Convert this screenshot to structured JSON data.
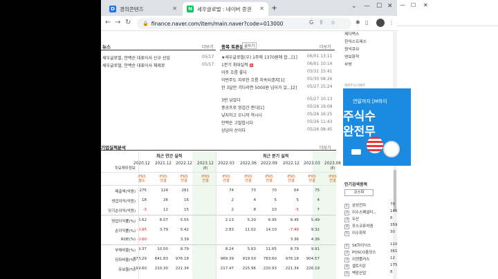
{
  "browser": {
    "tabs": [
      {
        "label": "경의콘텐즈",
        "favicon": "D",
        "favicon_color": "#1a73e8",
        "active": false
      },
      {
        "label": "세우글로벌 : 네이버 증권",
        "favicon": "N",
        "favicon_color": "#03c75a",
        "active": true
      }
    ],
    "url": "finance.naver.com/item/main.naver?code=013000"
  },
  "news": {
    "title": "뉴스",
    "more": "더보기",
    "items": [
      {
        "text": "세우글로벌, 안백순 대표이사 신규 선임",
        "date": "05/17"
      },
      {
        "text": "세우글로벌, 안백순 대표이사 체제로",
        "date": "05/17"
      }
    ]
  },
  "board": {
    "title": "종목 토론실",
    "write": "글쓰기",
    "more": "더보기",
    "items": [
      {
        "text": "★세우글로벌(우) 1주에 1370원에 합...[1]",
        "badge": true,
        "date": "06/01 13:11"
      },
      {
        "text": "1분기 최대실적",
        "badge": true,
        "date": "06/01 10:14"
      },
      {
        "text": "이주 흐름 좋다",
        "badge": false,
        "date": "05/31 15:41"
      },
      {
        "text": "이번주도 지루한 흐름 지속되겠지[1]",
        "badge": false,
        "date": "05/30 08:26"
      },
      {
        "text": "한 3달만 기다리면 5000원 넘어가 있...[2]",
        "badge": false,
        "date": "05/27 15:24"
      },
      {
        "text": "3번 남았다",
        "badge": false,
        "date": "05/27 10:13"
      },
      {
        "text": "중공프로 엉겁간 준다[1]",
        "badge": false,
        "date": "05/26 19:09"
      },
      {
        "text": "낮지하고 오니까 역시나",
        "badge": false,
        "date": "05/26 16:25"
      },
      {
        "text": "안백순 고발합시다",
        "badge": false,
        "date": "05/26 11:43"
      },
      {
        "text": "상넘어 산이다",
        "badge": false,
        "date": "05/26 08:45"
      }
    ]
  },
  "financials": {
    "title": "기업실적분석",
    "more": "더보기",
    "annual_label": "최근 연간 실적",
    "quarter_label": "최근 분기 실적",
    "main_info_label": "주요재무정보",
    "ifrs_label": "IFRS",
    "annual_cols": [
      {
        "year": "2020.12",
        "basis": "별도"
      },
      {
        "year": "2021.12",
        "basis": "연결"
      },
      {
        "year": "2022.12",
        "basis": "연결"
      },
      {
        "year": "2023.12",
        "suffix": "(E)",
        "basis": "연결"
      }
    ],
    "quarter_cols": [
      {
        "year": "2022.03",
        "basis": "연결"
      },
      {
        "year": "2022.06",
        "basis": "연결"
      },
      {
        "year": "2022.09",
        "basis": "연결"
      },
      {
        "year": "2022.12",
        "basis": "연결"
      },
      {
        "year": "2023.03",
        "basis": "연결"
      },
      {
        "year": "2023.06",
        "suffix": "(E)",
        "basis": "연결"
      }
    ],
    "rows": [
      {
        "label": "매출액(억원)",
        "a": [
          "275",
          "124",
          "281",
          ""
        ],
        "q": [
          "74",
          "73",
          "70",
          "64",
          "75",
          ""
        ]
      },
      {
        "label": "영업이익(억원)",
        "a": [
          "18",
          "26",
          "16",
          ""
        ],
        "q": [
          "2",
          "4",
          "5",
          "5",
          "4",
          ""
        ]
      },
      {
        "label": "당기순이익(억원)",
        "a": [
          "-3",
          "12",
          "15",
          ""
        ],
        "q": [
          "2",
          "8",
          "10",
          "-5",
          "7",
          ""
        ]
      },
      {
        "label": "영업이익률(%)",
        "a": [
          "6.62",
          "8.07",
          "5.55",
          ""
        ],
        "q": [
          "2.13",
          "5.20",
          "6.95",
          "8.45",
          "5.49",
          ""
        ]
      },
      {
        "label": "순이익률(%)",
        "a": [
          "-0.95",
          "3.79",
          "5.42",
          ""
        ],
        "q": [
          "2.83",
          "11.02",
          "14.10",
          "-7.49",
          "9.32",
          ""
        ]
      },
      {
        "label": "ROE(%)",
        "a": [
          "-0.60",
          "",
          "3.39",
          ""
        ],
        "q": [
          "",
          "",
          "",
          "3.36",
          "4.36",
          ""
        ]
      },
      {
        "label": "부채비율(%)",
        "a": [
          "9.37",
          "10.00",
          "8.79",
          ""
        ],
        "q": [
          "8.24",
          "5.63",
          "11.65",
          "8.79",
          "9.91",
          ""
        ]
      },
      {
        "label": "당좌비율(%)",
        "a": [
          "878.29",
          "841.83",
          "976.18",
          ""
        ],
        "q": [
          "969.39",
          "919.50",
          "783.60",
          "976.18",
          "904.57",
          ""
        ]
      },
      {
        "label": "유보율(%)",
        "a": [
          "199.60",
          "210.30",
          "221.34",
          ""
        ],
        "q": [
          "217.47",
          "215.96",
          "220.93",
          "221.34",
          "226.19",
          ""
        ]
      }
    ]
  },
  "right_panel": {
    "links": [
      "제다맥스",
      "한익스프레스",
      "원익큐브",
      "영보화학",
      "부방"
    ],
    "ad": {
      "line1": "연말까지 [M하이",
      "line2": "주식수",
      "line3": "완전무"
    },
    "ad_label": "해외주식 이벤트",
    "ranking_title": "인기검색종목",
    "ranking_tab": "코스피",
    "ranking": [
      {
        "n": "1",
        "name": "삼성전자",
        "val": "70"
      },
      {
        "n": "2",
        "name": "이수스페셜티...",
        "val": "140"
      },
      {
        "n": "3",
        "name": "두산",
        "val": "6"
      },
      {
        "n": "4",
        "name": "포스코퓨처엠",
        "val": "359"
      },
      {
        "n": "5",
        "name": "이수화학",
        "val": "30"
      },
      {
        "n": "1",
        "name": "SK하이닉스",
        "val": "110"
      },
      {
        "n": "2",
        "name": "POSCO홀딩스",
        "val": "361"
      },
      {
        "n": "3",
        "name": "이엔플러스",
        "val": "12"
      },
      {
        "n": "4",
        "name": "셀트리온",
        "val": "175"
      },
      {
        "n": "5",
        "name": "백광산업",
        "val": "8"
      }
    ]
  }
}
